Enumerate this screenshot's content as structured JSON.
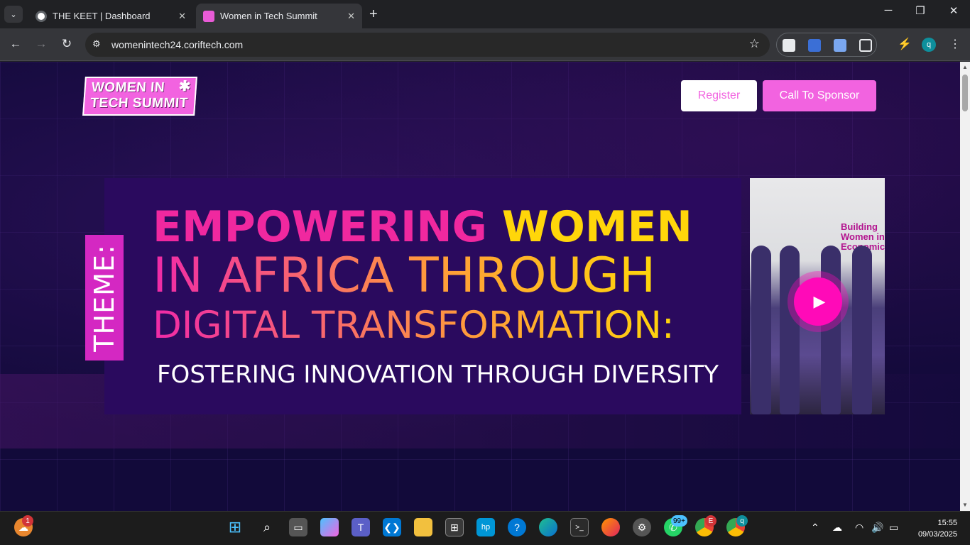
{
  "browser": {
    "tabs": [
      {
        "title": "THE KEET | Dashboard",
        "active": false
      },
      {
        "title": "Women in Tech Summit",
        "active": true
      }
    ],
    "url": "womenintech24.coriftech.com",
    "profile_initial": "q"
  },
  "site": {
    "logo_line1": "WOMEN IN",
    "logo_line2": "TECH SUMMIT",
    "register_label": "Register",
    "sponsor_label": "Call To Sponsor"
  },
  "hero": {
    "theme_label": "THEME:",
    "line1_a": "EMPOWERING",
    "line1_b": "WOMEN",
    "line2": "IN AFRICA THROUGH",
    "line3": "DIGITAL TRANSFORMATION:",
    "line4": "FOSTERING INNOVATION THROUGH DIVERSITY",
    "photo_text": "Building Women in Economic"
  },
  "taskbar": {
    "weather_badge": "1",
    "whatsapp_badge": "99+",
    "chrome_badge": "E",
    "chrome2_badge": "q",
    "time": "15:55",
    "date": "09/03/2025"
  },
  "colors": {
    "accent": "#f263e0",
    "page_bg": "#120a3a",
    "banner_bg": "#2a0a5e",
    "yellow": "#ffd60a"
  }
}
